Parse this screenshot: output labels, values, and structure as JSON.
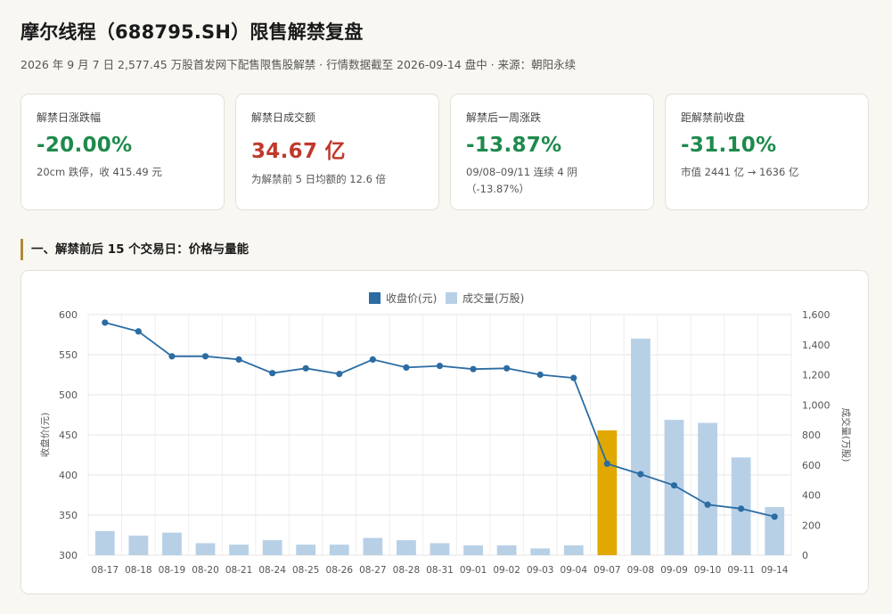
{
  "header": {
    "title": "摩尔线程（688795.SH）限售解禁复盘",
    "subtitle": "2026 年 9 月 7 日 2,577.45 万股首发网下配售限售股解禁 · 行情数据截至 2026-09-14 盘中 · 来源：朝阳永续"
  },
  "kpis": [
    {
      "label": "解禁日涨跌幅",
      "value": "-20.00%",
      "note": "20cm 跌停，收 415.49 元",
      "color": "#1e8a4c"
    },
    {
      "label": "解禁日成交额",
      "value": "34.67 亿",
      "note": "为解禁前 5 日均额的 12.6 倍",
      "color": "#c0392b"
    },
    {
      "label": "解禁后一周涨跌",
      "value": "-13.87%",
      "note": "09/08–09/11 连续 4 阴（-13.87%）",
      "color": "#1e8a4c"
    },
    {
      "label": "距解禁前收盘",
      "value": "-31.10%",
      "note": "市值 2441 亿 → 1636 亿",
      "color": "#1e8a4c"
    }
  ],
  "section": {
    "title": "一、解禁前后 15 个交易日：价格与量能"
  },
  "chart_data": {
    "type": "bar",
    "legend": [
      "收盘价(元)",
      "成交量(万股)"
    ],
    "legend_position": "top-center",
    "categories": [
      "08-17",
      "08-18",
      "08-19",
      "08-20",
      "08-21",
      "08-24",
      "08-25",
      "08-26",
      "08-27",
      "08-28",
      "08-31",
      "09-01",
      "09-02",
      "09-03",
      "09-04",
      "09-07",
      "09-08",
      "09-09",
      "09-10",
      "09-11",
      "09-14"
    ],
    "series": [
      {
        "name": "收盘价(元)",
        "type": "line",
        "axis": "left",
        "color": "#2b6ca3",
        "values": [
          590,
          579,
          548,
          548,
          544,
          527,
          533,
          526,
          544,
          534,
          536,
          532,
          533,
          525,
          521,
          414,
          401,
          387,
          363,
          358,
          348
        ]
      },
      {
        "name": "成交量(万股)",
        "type": "bar",
        "axis": "right",
        "color": "#b8d0e6",
        "highlight_color": "#e0a800",
        "highlight_index": 15,
        "values": [
          160,
          130,
          150,
          80,
          70,
          100,
          70,
          70,
          115,
          100,
          80,
          65,
          65,
          45,
          65,
          830,
          1440,
          900,
          880,
          650,
          320
        ]
      }
    ],
    "ylabel_left": "收盘价(元)",
    "ylabel_right": "成交量(万股)",
    "ylim_left": [
      300,
      600
    ],
    "ylim_right": [
      0,
      1600
    ],
    "yticks_left": [
      "600",
      "550",
      "500",
      "450",
      "400",
      "350",
      "300"
    ],
    "yticks_right": [
      "1,600",
      "1,400",
      "1,200",
      "1,000",
      "800",
      "600",
      "400",
      "200",
      "0"
    ],
    "grid": true
  }
}
